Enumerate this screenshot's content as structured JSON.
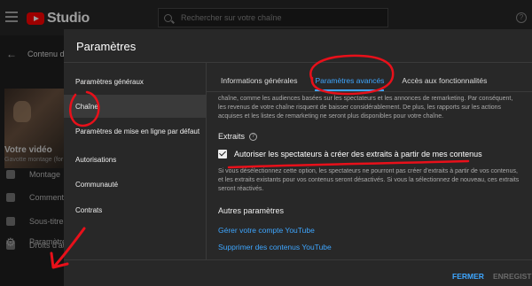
{
  "app": {
    "logo_text": "Studio",
    "search_placeholder": "Rechercher sur votre chaîne",
    "help_glyph": "?"
  },
  "leftnav": {
    "back_glyph": "←",
    "content_title": "Contenu de",
    "video_heading": "Votre vidéo",
    "video_sub": "Gavotte montage (for",
    "items": [
      {
        "label": "Montage"
      },
      {
        "label": "Commentaires"
      },
      {
        "label": "Sous-titres"
      },
      {
        "label": "Droits d'au"
      }
    ],
    "settings_label": "Paramètres",
    "settings_glyph": "⚙"
  },
  "dialog": {
    "title": "Paramètres",
    "sidebar": [
      {
        "label": "Paramètres généraux",
        "active": false
      },
      {
        "label": "Chaîne",
        "active": true
      },
      {
        "label": "Paramètres de mise en ligne par défaut",
        "active": false
      },
      {
        "label": "Autorisations",
        "active": false
      },
      {
        "label": "Communauté",
        "active": false
      },
      {
        "label": "Contrats",
        "active": false
      }
    ],
    "tabs": [
      {
        "label": "Informations générales",
        "active": false
      },
      {
        "label": "Paramètres avancés",
        "active": true
      },
      {
        "label": "Accès aux fonctionnalités",
        "active": false
      }
    ],
    "remarketing_text": "chaîne, comme les audiences basées sur les spectateurs et les annonces de remarketing. Par conséquent, les revenus de votre chaîne risquent de baisser considérablement. De plus, les rapports sur les actions acquises et les listes de remarketing ne seront plus disponibles pour votre chaîne.",
    "extraits": {
      "heading": "Extraits",
      "info_glyph": "?",
      "checkbox_label": "Autoriser les spectateurs à créer des extraits à partir de mes contenus",
      "checked": true,
      "description": "Si vous désélectionnez cette option, les spectateurs ne pourront pas créer d'extraits à partir de vos contenus, et les extraits existants pour vos contenus seront désactivés. Si vous la sélectionnez de nouveau, ces extraits seront réactivés."
    },
    "autres": {
      "heading": "Autres paramètres",
      "links": [
        "Gérer votre compte YouTube",
        "Supprimer des contenus YouTube"
      ]
    },
    "footer": {
      "close_label": "FERMER",
      "save_label": "ENREGISTRER"
    }
  },
  "colors": {
    "accent": "#3ea6ff",
    "annotation": "#e8101a",
    "brand": "#ff0000"
  }
}
